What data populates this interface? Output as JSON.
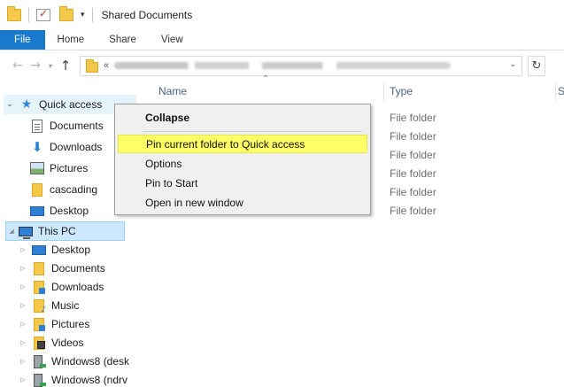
{
  "window": {
    "title": "Shared Documents"
  },
  "ribbon": {
    "tabs": [
      "File",
      "Home",
      "Share",
      "View"
    ]
  },
  "address": {
    "collapsed_indicator": "«",
    "path_blurred": true
  },
  "navpane": {
    "quick_access": {
      "label": "Quick access",
      "items": [
        "Documents",
        "Downloads",
        "Pictures",
        "cascading",
        "Desktop"
      ]
    },
    "this_pc": {
      "label": "This PC",
      "items": [
        "Desktop",
        "Documents",
        "Downloads",
        "Music",
        "Pictures",
        "Videos",
        "Windows8 (desk",
        "Windows8 (ndrv"
      ]
    }
  },
  "content": {
    "columns": {
      "name": "Name",
      "type": "Type",
      "size_partial": "S"
    },
    "types": [
      "File folder",
      "File folder",
      "File folder",
      "File folder",
      "File folder",
      "File folder"
    ]
  },
  "context_menu": {
    "items": [
      "Collapse",
      "Pin current folder to Quick access",
      "Options",
      "Pin to Start",
      "Open in new window"
    ],
    "highlighted_index": 1
  },
  "colors": {
    "file_tab": "#1979ca",
    "highlight": "#ffff66",
    "selection": "#cce8ff"
  }
}
